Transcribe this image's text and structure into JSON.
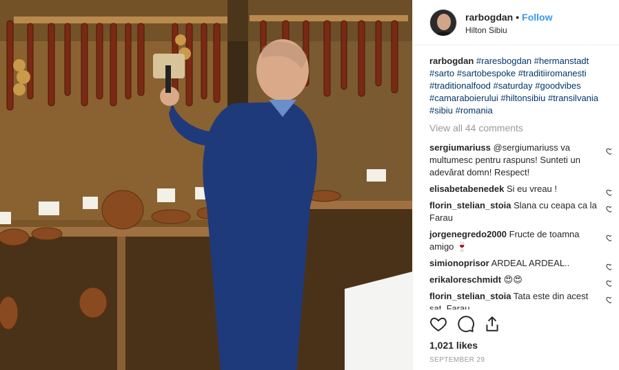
{
  "post": {
    "username": "rarbogdan",
    "separator": "•",
    "follow_label": "Follow",
    "location": "Hilton Sibiu",
    "caption": {
      "username": "rarbogdan",
      "hashtags": [
        "#raresbogdan",
        "#hermanstadt",
        "#sarto",
        "#sartobespoke",
        "#traditiiromanesti",
        "#traditionalfood",
        "#saturday",
        "#goodvibes",
        "#camaraboierului",
        "#hiltonsibiu",
        "#transilvania",
        "#sibiu",
        "#romania"
      ]
    },
    "view_all_comments": "View all 44 comments",
    "comments": [
      {
        "user": "sergiumariuss",
        "text": "@sergiumariuss va multumesc pentru raspuns! Sunteti un adevărat domn! Respect!"
      },
      {
        "user": "elisabetabenedek",
        "text": "Si eu vreau !"
      },
      {
        "user": "florin_stelian_stoia",
        "text": "Slana cu ceapa ca la Farau"
      },
      {
        "user": "jorgenegredo2000",
        "text": "Fructe de toamna amigo 🍷"
      },
      {
        "user": "simionoprisor",
        "text": "ARDEAL ARDEAL.."
      },
      {
        "user": "erikaloreschmidt",
        "text": "😍😍"
      },
      {
        "user": "florin_stelian_stoia",
        "text": "Tata este din acest sat, Farau"
      }
    ],
    "likes": "1,021 likes",
    "date": "SEPTEMBER 29"
  },
  "icons": {
    "like": "heart-icon",
    "comment": "comment-icon",
    "share": "share-icon",
    "save": "bookmark-icon",
    "comment_like": "heart-icon"
  },
  "colors": {
    "link": "#3897f0",
    "hashtag": "#003569",
    "muted": "#999999",
    "text": "#262626"
  }
}
